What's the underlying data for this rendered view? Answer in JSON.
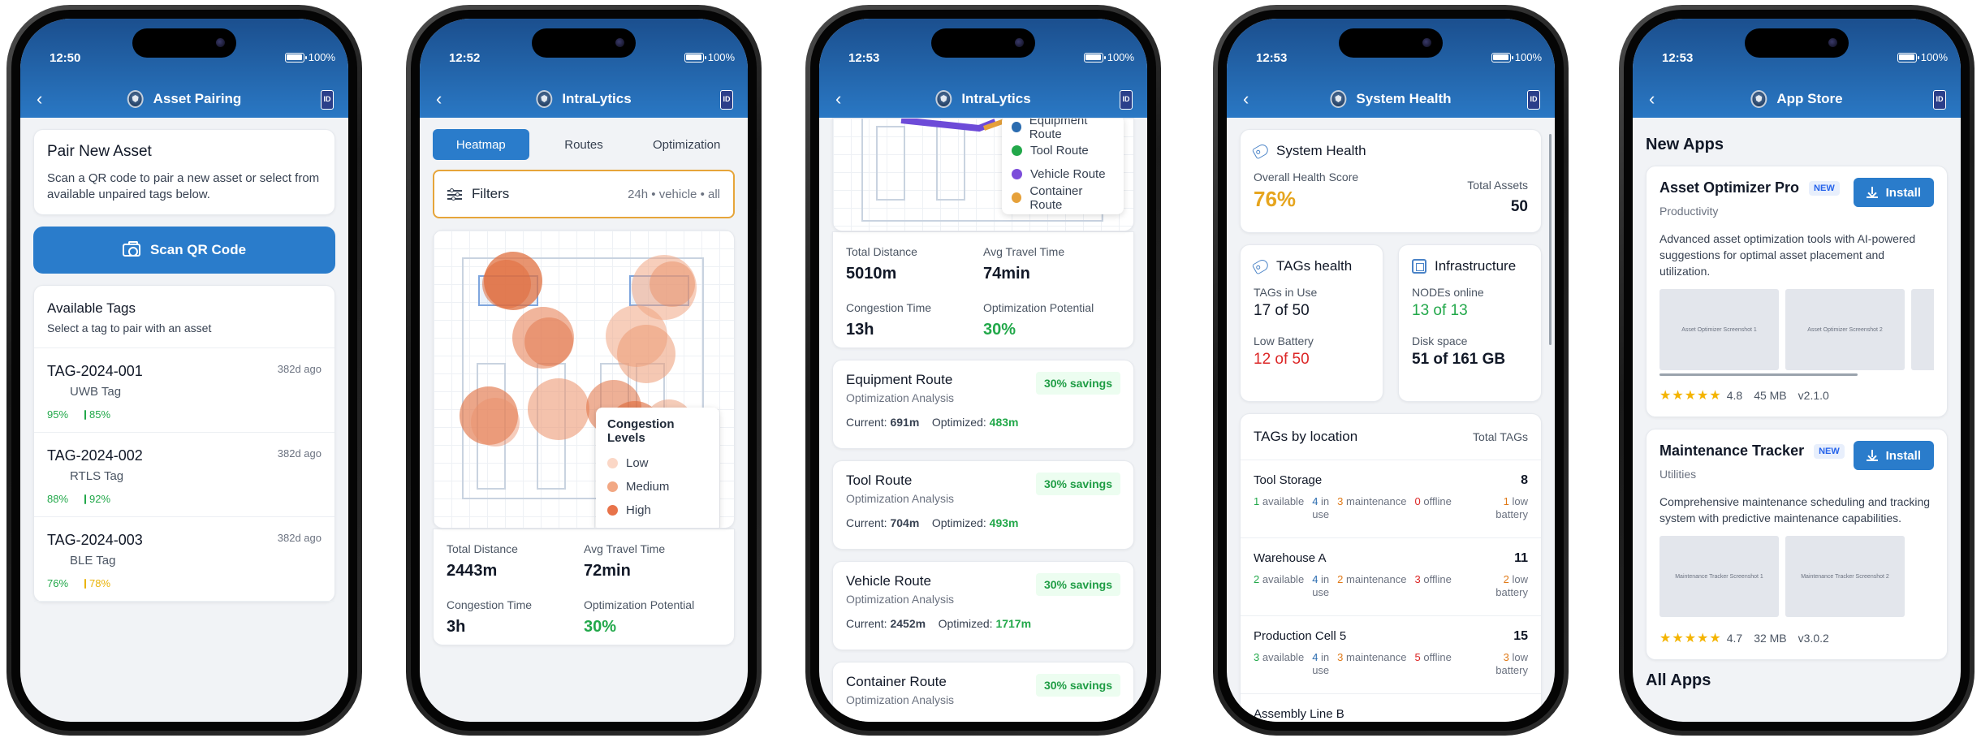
{
  "status": {
    "battery": "100%"
  },
  "screens": {
    "pairing": {
      "time": "12:50",
      "title": "Asset Pairing",
      "pair_title": "Pair New Asset",
      "pair_desc": "Scan a QR code to pair a new asset or select from available unpaired tags below.",
      "scan_button": "Scan QR Code",
      "available_title": "Available Tags",
      "available_sub": "Select a tag to pair with an asset",
      "tags": [
        {
          "id": "TAG-2024-001",
          "type": "UWB Tag",
          "ago": "382d ago",
          "p1": "95%",
          "p2": "85%"
        },
        {
          "id": "TAG-2024-002",
          "type": "RTLS Tag",
          "ago": "382d ago",
          "p1": "88%",
          "p2": "92%"
        },
        {
          "id": "TAG-2024-003",
          "type": "BLE Tag",
          "ago": "382d ago",
          "p1": "76%",
          "p2": "78%"
        }
      ]
    },
    "heatmap": {
      "time": "12:52",
      "title": "IntraLytics",
      "tabs": [
        "Heatmap",
        "Routes",
        "Optimization"
      ],
      "filters_label": "Filters",
      "filters_summary": "24h  •  vehicle  •  all",
      "legend_title": "Congestion Levels",
      "legend": [
        "Low",
        "Medium",
        "High"
      ],
      "stats": {
        "total_distance_label": "Total Distance",
        "total_distance": "2443m",
        "avg_travel_label": "Avg Travel Time",
        "avg_travel": "72min",
        "congestion_label": "Congestion Time",
        "congestion": "3h",
        "optimization_label": "Optimization Potential",
        "optimization": "30%"
      }
    },
    "routes": {
      "time": "12:53",
      "title": "IntraLytics",
      "legend": [
        "Equipment Route",
        "Tool Route",
        "Vehicle Route",
        "Container Route"
      ],
      "stats": {
        "total_distance_label": "Total Distance",
        "total_distance": "5010m",
        "avg_travel_label": "Avg Travel Time",
        "avg_travel": "74min",
        "congestion_label": "Congestion Time",
        "congestion": "13h",
        "optimization_label": "Optimization Potential",
        "optimization": "30%"
      },
      "route_sub": "Optimization Analysis",
      "current_label": "Current:",
      "optimized_label": "Optimized:",
      "items": [
        {
          "name": "Equipment Route",
          "savings": "30% savings",
          "current": "691m",
          "optimized": "483m"
        },
        {
          "name": "Tool Route",
          "savings": "30% savings",
          "current": "704m",
          "optimized": "493m"
        },
        {
          "name": "Vehicle Route",
          "savings": "30% savings",
          "current": "2452m",
          "optimized": "1717m"
        },
        {
          "name": "Container Route",
          "savings": "30% savings",
          "current": "",
          "optimized": ""
        }
      ]
    },
    "health": {
      "time": "12:53",
      "title": "System Health",
      "card_title": "System Health",
      "overall_label": "Overall Health Score",
      "overall": "76%",
      "assets_label": "Total Assets",
      "assets": "50",
      "tags_health_title": "TAGs health",
      "tags_in_use_label": "TAGs in Use",
      "tags_in_use": "17 of 50",
      "low_battery_label": "Low Battery",
      "low_battery": "12 of 50",
      "infra_title": "Infrastructure",
      "nodes_label": "NODEs online",
      "nodes": "13 of 13",
      "disk_label": "Disk space",
      "disk": "51 of 161 GB",
      "by_location_title": "TAGs by location",
      "total_tags_label": "Total TAGs",
      "locations": [
        {
          "name": "Tool Storage",
          "total": "8",
          "available": "1",
          "in_use": "4",
          "maintenance": "3",
          "offline": "0",
          "low": "1"
        },
        {
          "name": "Warehouse A",
          "total": "11",
          "available": "2",
          "in_use": "4",
          "maintenance": "2",
          "offline": "3",
          "low": "2"
        },
        {
          "name": "Production Cell 5",
          "total": "15",
          "available": "3",
          "in_use": "4",
          "maintenance": "3",
          "offline": "5",
          "low": "3"
        },
        {
          "name": "Assembly Line B",
          "total": "",
          "available": "",
          "in_use": "",
          "maintenance": "",
          "offline": "",
          "low": ""
        }
      ],
      "w_available": "available",
      "w_in": "in",
      "w_use": "use",
      "w_maintenance": "maintenance",
      "w_offline": "offline",
      "w_low": "low",
      "w_battery": "battery"
    },
    "store": {
      "time": "12:53",
      "title": "App Store",
      "new_apps": "New Apps",
      "all_apps": "All Apps",
      "new_badge": "NEW",
      "install": "Install",
      "apps": [
        {
          "name": "Asset Optimizer Pro",
          "category": "Productivity",
          "desc": "Advanced asset optimization tools with AI-powered suggestions for optimal asset placement and utilization.",
          "shots": [
            "Asset Optimizer Screenshot 1",
            "Asset Optimizer Screenshot 2"
          ],
          "rating": "4.8",
          "size": "45 MB",
          "version": "v2.1.0"
        },
        {
          "name": "Maintenance Tracker",
          "category": "Utilities",
          "desc": "Comprehensive maintenance scheduling and tracking system with predictive maintenance capabilities.",
          "shots": [
            "Maintenance Tracker Screenshot 1",
            "Maintenance Tracker Screenshot 2"
          ],
          "rating": "4.7",
          "size": "32 MB",
          "version": "v3.0.2"
        }
      ]
    }
  },
  "colors": {
    "primary": "#2a7ccb",
    "green": "#22a84a",
    "red": "#dc2626",
    "amber": "#eab308",
    "heat": "#e8734a"
  }
}
